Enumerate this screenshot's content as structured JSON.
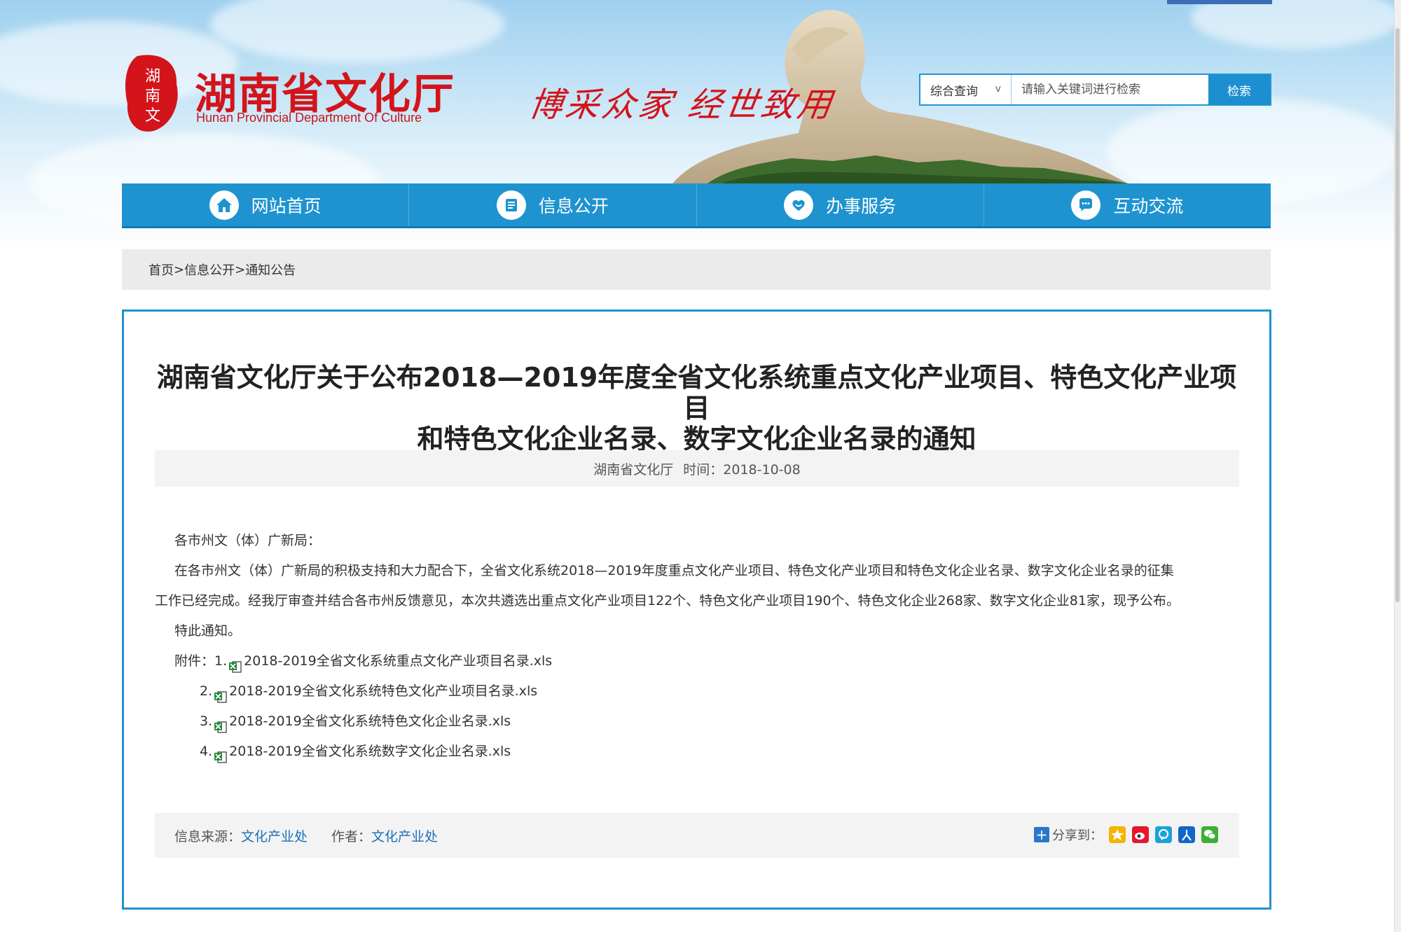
{
  "header": {
    "logo_title": "湖南省文化厅",
    "logo_subtitle": "Hunan Provincial Department Of Culture",
    "slogan": "博采众家 经世致用"
  },
  "search": {
    "scope_label": "综合查询",
    "scope_chevron": "v",
    "placeholder": "请输入关键词进行检索",
    "button_label": "检索"
  },
  "nav": {
    "items": [
      {
        "label": "网站首页",
        "icon": "home-icon"
      },
      {
        "label": "信息公开",
        "icon": "document-icon"
      },
      {
        "label": "办事服务",
        "icon": "heart-hand-icon"
      },
      {
        "label": "互动交流",
        "icon": "chat-icon"
      }
    ]
  },
  "breadcrumb": {
    "home": "首页",
    "sep1": ">",
    "level1": "信息公开",
    "sep2": ">",
    "level2": "通知公告"
  },
  "article": {
    "title_line1": "湖南省文化厅关于公布2018—2019年度全省文化系统重点文化产业项目、特色文化产业项目",
    "title_line2": "和特色文化企业名录、数字文化企业名录的通知",
    "publisher": "湖南省文化厅",
    "time_label": "时间：2018-10-08",
    "salutation": "各市州文（体）广新局：",
    "para1_line1": "在各市州文（体）广新局的积极支持和大力配合下，全省文化系统2018—2019年度重点文化产业项目、特色文化产业项目和特色文化企业名录、数字文化企业名录的征集",
    "para1_line2": "工作已经完成。经我厅审查并结合各市州反馈意见，本次共遴选出重点文化产业项目122个、特色文化产业项目190个、特色文化企业268家、数字文化企业81家，现予公布。",
    "closing": "特此通知。",
    "attachments_label": "附件：",
    "attachments": [
      {
        "num": "1.",
        "name": "2018-2019全省文化系统重点文化产业项目名录.xls"
      },
      {
        "num": "2.",
        "name": "2018-2019全省文化系统特色文化产业项目名录.xls"
      },
      {
        "num": "3.",
        "name": "2018-2019全省文化系统特色文化企业名录.xls"
      },
      {
        "num": "4.",
        "name": "2018-2019全省文化系统数字文化企业名录.xls"
      }
    ],
    "source_label": "信息来源：",
    "source_value": "文化产业处",
    "author_label": "作者：",
    "author_value": "文化产业处",
    "share_label": "分享到：",
    "share_icons": [
      "qzone-icon",
      "weibo-icon",
      "tencent-weibo-icon",
      "renren-icon",
      "wechat-icon"
    ]
  },
  "colors": {
    "brand_red": "#d3141b",
    "nav_blue": "#1e93cf",
    "link_blue": "#1d6fb8"
  }
}
